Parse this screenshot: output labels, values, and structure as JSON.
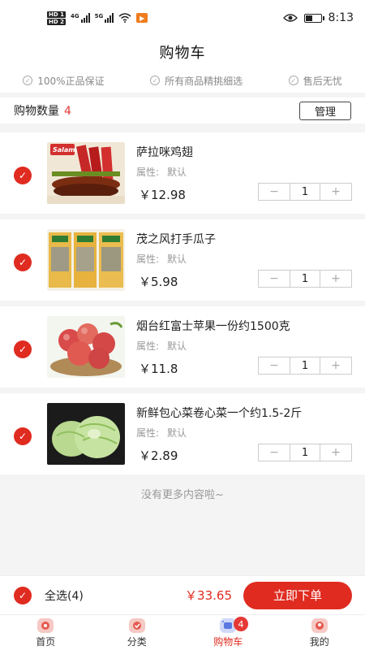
{
  "status_bar": {
    "hd1": "HD 1",
    "hd2": "HD 2",
    "net1": "4G",
    "net2": "5G",
    "time": "8:13"
  },
  "header": {
    "title": "购物车"
  },
  "guarantees": [
    {
      "label": "100%正品保证",
      "icon": "check-circle-icon"
    },
    {
      "label": "所有商品精挑细选",
      "icon": "check-circle-icon"
    },
    {
      "label": "售后无忧",
      "icon": "check-circle-icon"
    }
  ],
  "cart": {
    "count_label": "购物数量",
    "count": "4",
    "manage_label": "管理"
  },
  "items": [
    {
      "title": "萨拉咪鸡翅",
      "attr_label": "属性:",
      "attr_value": "默认",
      "price": "￥12.98",
      "qty": "1",
      "minus": "−",
      "plus": "+"
    },
    {
      "title": "茂之风打手瓜子",
      "attr_label": "属性:",
      "attr_value": "默认",
      "price": "￥5.98",
      "qty": "1",
      "minus": "−",
      "plus": "+"
    },
    {
      "title": "烟台红富士苹果一份约1500克",
      "attr_label": "属性:",
      "attr_value": "默认",
      "price": "￥11.8",
      "qty": "1",
      "minus": "−",
      "plus": "+"
    },
    {
      "title": "新鲜包心菜卷心菜一个约1.5-2斤",
      "attr_label": "属性:",
      "attr_value": "默认",
      "price": "￥2.89",
      "qty": "1",
      "minus": "−",
      "plus": "+"
    }
  ],
  "item_images": {
    "salami_brand": "Salami"
  },
  "no_more": "没有更多内容啦~",
  "checkout": {
    "select_all": "全选(4)",
    "total": "￥33.65",
    "order_label": "立即下单"
  },
  "tabs": [
    {
      "label": "首页",
      "icon": "home-icon"
    },
    {
      "label": "分类",
      "icon": "category-icon"
    },
    {
      "label": "购物车",
      "icon": "cart-icon",
      "badge": "4",
      "active": true
    },
    {
      "label": "我的",
      "icon": "user-icon"
    }
  ],
  "colors": {
    "accent": "#e02b20",
    "text": "#222222",
    "muted": "#999999",
    "background": "#f4f4f4"
  }
}
